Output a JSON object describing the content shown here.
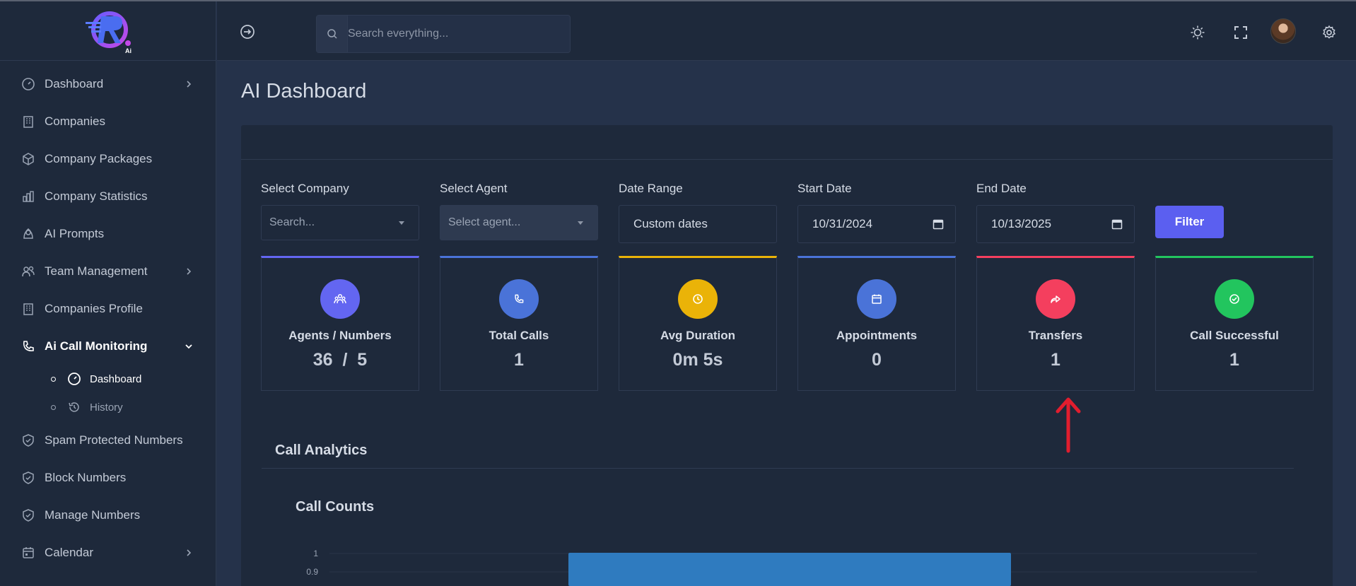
{
  "app": {
    "logo_badge": "Ai"
  },
  "sidebar": {
    "items": [
      {
        "label": "Dashboard",
        "icon": "gauge-icon",
        "has_chevron": true
      },
      {
        "label": "Companies",
        "icon": "building-icon"
      },
      {
        "label": "Company Packages",
        "icon": "package-icon"
      },
      {
        "label": "Company Statistics",
        "icon": "bar-chart-icon"
      },
      {
        "label": "AI Prompts",
        "icon": "location-pin-icon"
      },
      {
        "label": "Team Management",
        "icon": "users-icon",
        "has_chevron": true
      },
      {
        "label": "Companies Profile",
        "icon": "building-icon"
      },
      {
        "label": "Ai Call Monitoring",
        "icon": "phone-icon",
        "expanded": true,
        "active": true
      },
      {
        "label": "Spam Protected Numbers",
        "icon": "shield-check-icon"
      },
      {
        "label": "Block Numbers",
        "icon": "shield-check-icon"
      },
      {
        "label": "Manage Numbers",
        "icon": "shield-check-icon"
      },
      {
        "label": "Calendar",
        "icon": "calendar-icon",
        "has_chevron": true
      }
    ],
    "sub_items": [
      {
        "label": "Dashboard",
        "icon": "gauge-icon",
        "active": true
      },
      {
        "label": "History",
        "icon": "history-icon"
      }
    ]
  },
  "header": {
    "search_placeholder": "Search everything...",
    "icons": [
      "sidebar-toggle-icon",
      "sun-icon",
      "fullscreen-icon",
      "avatar",
      "gear-icon"
    ]
  },
  "page": {
    "title": "AI Dashboard"
  },
  "filters": {
    "company_label": "Select Company",
    "company_placeholder": "Search...",
    "agent_label": "Select Agent",
    "agent_placeholder": "Select agent...",
    "date_range_label": "Date Range",
    "date_range_value": "Custom dates",
    "start_label": "Start Date",
    "start_value": "10/31/2024",
    "end_label": "End Date",
    "end_value": "10/13/2025",
    "filter_button": "Filter"
  },
  "stats": [
    {
      "label": "Agents / Numbers",
      "value": "36  /  5",
      "color": "#6366f1",
      "icon": "users-group-icon"
    },
    {
      "label": "Total Calls",
      "value": "1",
      "color": "#4a73d8",
      "icon": "phone-icon"
    },
    {
      "label": "Avg Duration",
      "value": "0m 5s",
      "color": "#eab308",
      "icon": "clock-icon"
    },
    {
      "label": "Appointments",
      "value": "0",
      "color": "#4a73d8",
      "icon": "calendar-icon"
    },
    {
      "label": "Transfers",
      "value": "1",
      "color": "#f43f5e",
      "icon": "forward-arrow-icon"
    },
    {
      "label": "Call Successful",
      "value": "1",
      "color": "#22c55e",
      "icon": "check-circle-icon"
    }
  ],
  "analytics": {
    "section_title": "Call Analytics"
  },
  "chart_data": {
    "type": "bar",
    "title": "Call Counts",
    "categories": [
      ""
    ],
    "values": [
      1
    ],
    "ytick_labels": [
      "1",
      "0.9"
    ],
    "ylim": [
      0,
      1
    ],
    "bar_color": "#2f7bbf"
  },
  "annotation": {
    "color": "#e11d2e",
    "target": "Transfers"
  }
}
